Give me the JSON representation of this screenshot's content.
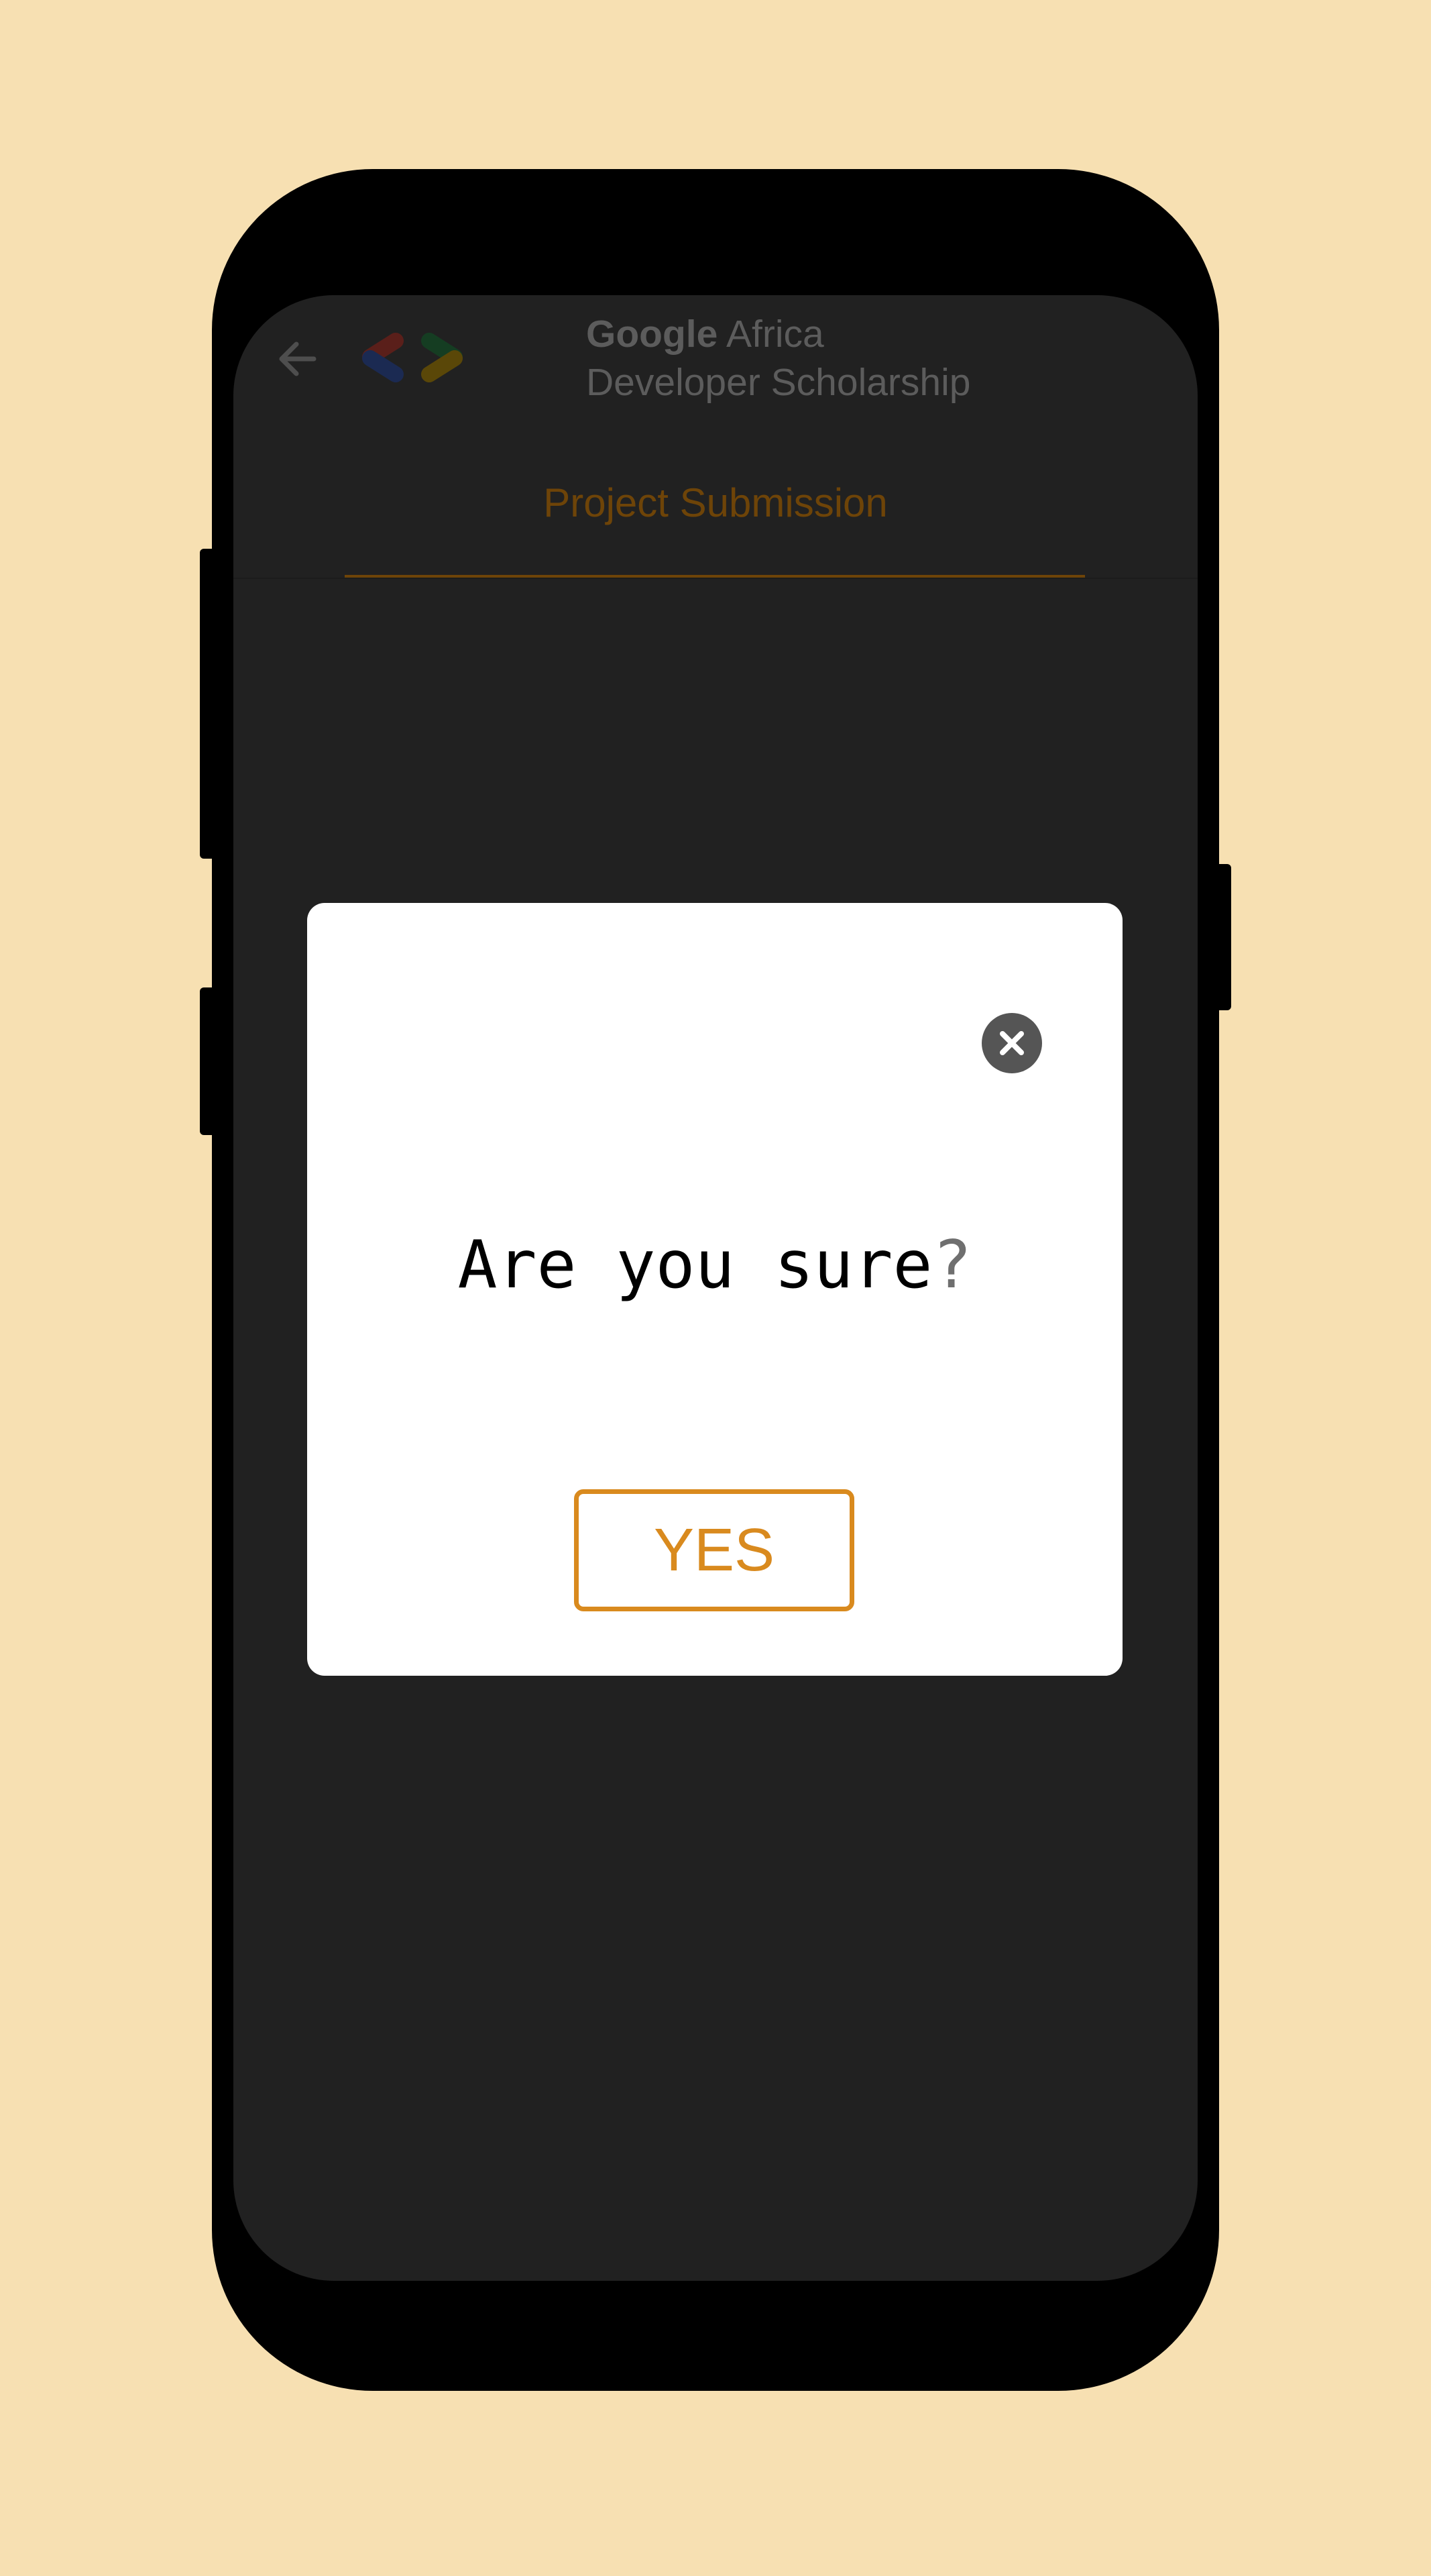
{
  "header": {
    "back_icon": "arrow-left-icon",
    "logo_icon": "google-developers-logo-icon",
    "title_brand": "Google",
    "title_rest": " Africa",
    "subtitle": "Developer Scholarship"
  },
  "tabs": [
    {
      "label": "Project Submission",
      "selected": true
    }
  ],
  "dialog": {
    "close_icon": "close-icon",
    "question_text": "Are you sure",
    "question_mark": "?",
    "confirm_label": "YES"
  },
  "colors": {
    "background": "#f7e0b2",
    "screen": "#212121",
    "accent": "#d98a1e",
    "dimmed_accent": "#6e4408",
    "dialog": "#ffffff"
  }
}
